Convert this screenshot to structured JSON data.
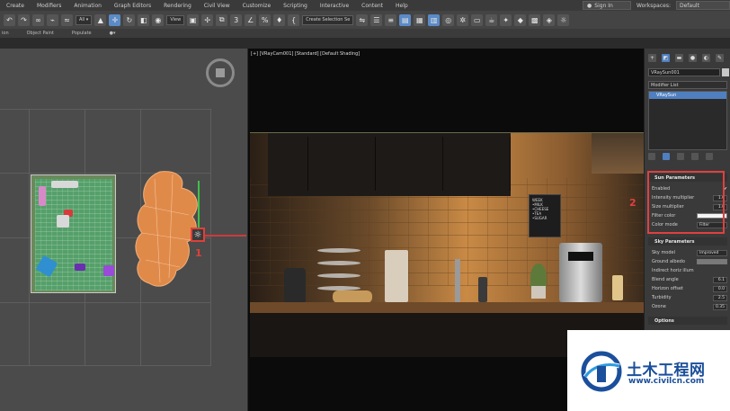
{
  "menubar": {
    "items": [
      "Create",
      "Modifiers",
      "Animation",
      "Graph Editors",
      "Rendering",
      "Civil View",
      "Customize",
      "Scripting",
      "Interactive",
      "Content",
      "Help"
    ],
    "sign_in": "Sign In",
    "workspaces_label": "Workspaces:",
    "workspace_value": "Default"
  },
  "toolbar": {
    "view_select": "View",
    "selection_set": "Create Selection Se"
  },
  "subbar": {
    "items": [
      "ion",
      "Object Paint",
      "Populate"
    ]
  },
  "viewport": {
    "caption": "[+] [VRayCam001] [Standard] [Default Shading]",
    "marker_1": "1",
    "marker_2": "2",
    "sign_lines": [
      "WEEK",
      "•MILK",
      "•CHEESE",
      "•TEA",
      "•SUGAR"
    ]
  },
  "panel": {
    "object_name": "VRaySun001",
    "modifier_list": "Modifier List",
    "stack_item": "VRaySun",
    "sun_title": "Sun Parameters",
    "enabled_label": "Enabled",
    "enabled_check": "✔",
    "intensity_label": "Intensity multiplier",
    "intensity_value": "1.0",
    "size_label": "Size multiplier",
    "size_value": "1.0",
    "filter_label": "Filter color",
    "color_mode_label": "Color mode",
    "color_mode_value": "Filter",
    "sky_title": "Sky Parameters",
    "sky_model_label": "Sky model",
    "sky_model_value": "Improved",
    "ground_label": "Ground albedo",
    "indirect_label": "Indirect horiz illum",
    "blend_label": "Blend angle",
    "blend_value": "6.1",
    "horizon_label": "Horizon offset",
    "horizon_value": "0.0",
    "turbidity_label": "Turbidity",
    "turbidity_value": "2.5",
    "ozone_label": "Ozone",
    "ozone_value": "0.35",
    "options_title": "Options"
  },
  "watermark": {
    "title": "土木工程网",
    "url": "www.civilcn.com"
  },
  "colors": {
    "accent_blue": "#4f7fbf",
    "highlight_red": "#e04040",
    "watermark_blue": "#1b4f9b"
  }
}
